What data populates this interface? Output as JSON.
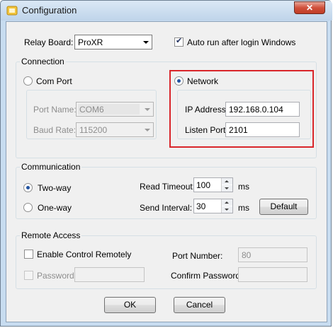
{
  "window": {
    "title": "Configuration",
    "close_glyph": "✕"
  },
  "relay": {
    "label": "Relay Board:",
    "value": "ProXR"
  },
  "autorun": {
    "label": "Auto run after login Windows",
    "checked": true
  },
  "connection": {
    "group_title": "Connection",
    "com_port_label": "Com Port",
    "port_name_label": "Port Name:",
    "port_name_value": "COM6",
    "baud_rate_label": "Baud Rate:",
    "baud_rate_value": "115200",
    "network_label": "Network",
    "ip_label": "IP Address:",
    "ip_value": "192.168.0.104",
    "listen_port_label": "Listen Port:",
    "listen_port_value": "2101",
    "highlight_color": "#d9252a"
  },
  "communication": {
    "group_title": "Communication",
    "two_way_label": "Two-way",
    "one_way_label": "One-way",
    "read_timeout_label": "Read Timeout:",
    "read_timeout_value": "100",
    "read_timeout_unit": "ms",
    "send_interval_label": "Send Interval:",
    "send_interval_value": "30",
    "send_interval_unit": "ms",
    "default_button": "Default"
  },
  "remote": {
    "group_title": "Remote Access",
    "enable_label": "Enable Control Remotely",
    "port_number_label": "Port Number:",
    "port_number_value": "80",
    "password_label": "Password:",
    "confirm_password_label": "Confirm Password:"
  },
  "footer": {
    "ok": "OK",
    "cancel": "Cancel"
  }
}
